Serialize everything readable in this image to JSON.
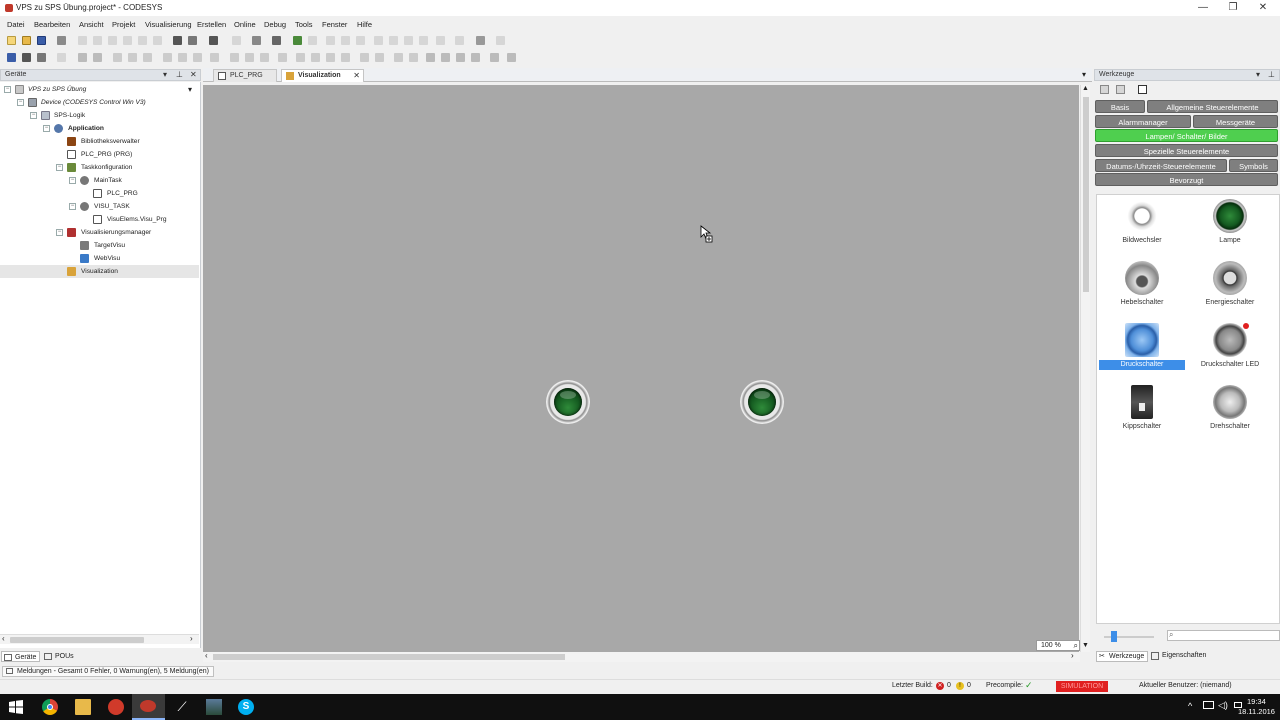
{
  "window": {
    "title": "VPS zu SPS Übung.project* - CODESYS",
    "minimize": "—",
    "maximize": "❐",
    "close": "✕"
  },
  "menu": [
    "Datei",
    "Bearbeiten",
    "Ansicht",
    "Projekt",
    "Visualisierung",
    "Erstellen",
    "Online",
    "Debug",
    "Tools",
    "Fenster",
    "Hilfe"
  ],
  "devices_panel": {
    "title": "Geräte",
    "tree": [
      {
        "label": "VPS zu SPS Übung",
        "style": "italic"
      },
      {
        "label": "Device (CODESYS Control Win V3)",
        "style": "italic"
      },
      {
        "label": "SPS-Logik"
      },
      {
        "label": "Application",
        "style": "bold"
      },
      {
        "label": "Bibliotheksverwalter"
      },
      {
        "label": "PLC_PRG (PRG)"
      },
      {
        "label": "Taskkonfiguration"
      },
      {
        "label": "MainTask"
      },
      {
        "label": "PLC_PRG"
      },
      {
        "label": "VISU_TASK"
      },
      {
        "label": "VisuElems.Visu_Prg"
      },
      {
        "label": "Visualisierungsmanager"
      },
      {
        "label": "TargetVisu"
      },
      {
        "label": "WebVisu"
      },
      {
        "label": "Visualization",
        "selected": true
      }
    ],
    "bottom_tabs": [
      "Geräte",
      "POUs"
    ]
  },
  "editor": {
    "tabs": [
      {
        "label": "PLC_PRG"
      },
      {
        "label": "Visualization",
        "active": true
      }
    ],
    "close_glyph": "✕",
    "canvas_color": "#a8a8a8",
    "zoom": "100 %"
  },
  "toolbox": {
    "title": "Werkzeuge",
    "categories": [
      {
        "label": "Basis"
      },
      {
        "label": "Allgemeine Steuerelemente"
      },
      {
        "label": "Alarmmanager"
      },
      {
        "label": "Messgeräte"
      },
      {
        "label": "Lampen/ Schalter/ Bilder",
        "active": true
      },
      {
        "label": "Spezielle Steuerelemente"
      },
      {
        "label": "Datums-/Uhrzeit-Steuerelemente"
      },
      {
        "label": "Symbols"
      },
      {
        "label": "Bevorzugt"
      }
    ],
    "items": [
      {
        "label": "Bildwechsler",
        "icon": "camera-switch-icon"
      },
      {
        "label": "Lampe",
        "icon": "lamp-icon"
      },
      {
        "label": "Hebelschalter",
        "icon": "lever-switch-icon"
      },
      {
        "label": "Energieschalter",
        "icon": "power-switch-icon"
      },
      {
        "label": "Druckschalter",
        "icon": "push-switch-icon",
        "selected": true
      },
      {
        "label": "Druckschalter LED",
        "icon": "push-switch-led-icon"
      },
      {
        "label": "Kippschalter",
        "icon": "toggle-switch-icon"
      },
      {
        "label": "Drehschalter",
        "icon": "rotary-switch-icon"
      }
    ],
    "bottom_tabs": [
      "Werkzeuge",
      "Eigenschaften"
    ]
  },
  "messages": "Meldungen - Gesamt 0 Fehler, 0 Warnung(en), 5 Meldung(en)",
  "status": {
    "last_build_label": "Letzter Build:",
    "errors": "0",
    "warnings": "0",
    "precompile_label": "Precompile:",
    "simulation": "SIMULATION",
    "current_user": "Aktueller Benutzer: (niemand)"
  },
  "taskbar": {
    "time": "19:34",
    "date": "18.11.2016"
  },
  "colors": {
    "accent_green": "#4fcf4f",
    "category_gray": "#7f7f7f",
    "selection_blue": "#3d8ee8",
    "simulation_red": "#e02020"
  }
}
